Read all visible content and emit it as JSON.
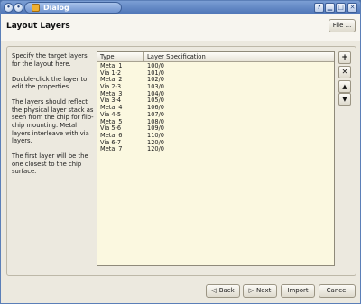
{
  "window": {
    "title": "Dialog"
  },
  "header": {
    "title": "Layout Layers",
    "file_button": "File ..."
  },
  "help": {
    "paragraphs": [
      "Specify the target layers for the layout here.",
      "Double-click the layer to edit the properties.",
      "The layers should reflect the physical layer stack as seen from the chip for flip-chip mounting. Metal layers interleave with via layers.",
      "The first layer will be the one closest to the chip surface."
    ]
  },
  "table": {
    "columns": [
      "Type",
      "Layer Specification"
    ],
    "rows": [
      {
        "type": "Metal 1",
        "spec": "100/0"
      },
      {
        "type": "Via 1-2",
        "spec": "101/0"
      },
      {
        "type": "Metal 2",
        "spec": "102/0"
      },
      {
        "type": "Via 2-3",
        "spec": "103/0"
      },
      {
        "type": "Metal 3",
        "spec": "104/0"
      },
      {
        "type": "Via 3-4",
        "spec": "105/0"
      },
      {
        "type": "Metal 4",
        "spec": "106/0"
      },
      {
        "type": "Via 4-5",
        "spec": "107/0"
      },
      {
        "type": "Metal 5",
        "spec": "108/0"
      },
      {
        "type": "Via 5-6",
        "spec": "109/0"
      },
      {
        "type": "Metal 6",
        "spec": "110/0"
      },
      {
        "type": "Via 6-7",
        "spec": "120/0"
      },
      {
        "type": "Metal 7",
        "spec": "120/0"
      }
    ]
  },
  "tools": {
    "add": "+",
    "remove": "✕",
    "move_up": "▲",
    "move_down": "▼"
  },
  "footer": {
    "back": "Back",
    "next": "Next",
    "import": "Import",
    "cancel": "Cancel"
  }
}
